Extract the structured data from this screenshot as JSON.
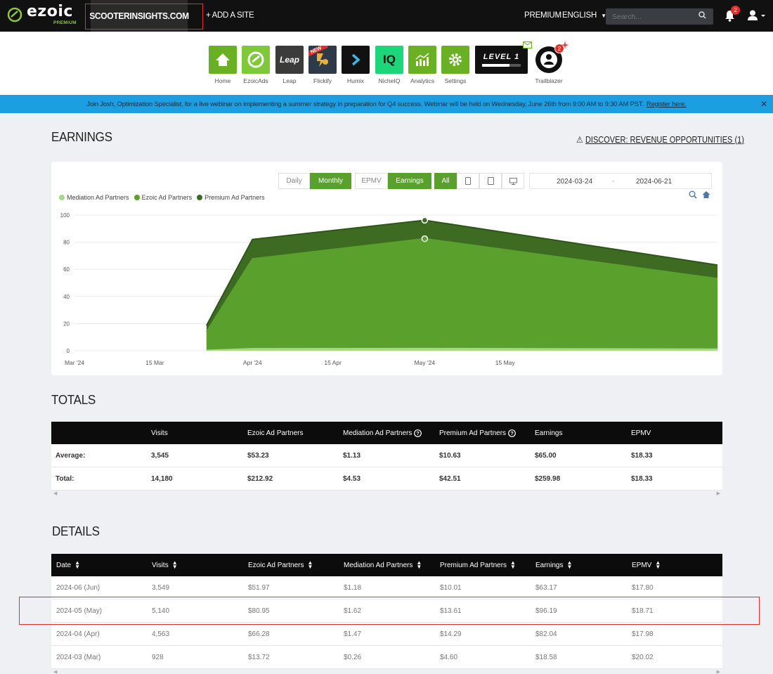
{
  "nav": {
    "logo": "ezoic",
    "logo_sub": "PREMIUM",
    "site": "SCOOTERINSIGHTS.COM",
    "add_site": "+ ADD A SITE",
    "premium": "PREMIUM",
    "language": "ENGLISH",
    "search_placeholder": "Search...",
    "notification_count": "2"
  },
  "apps": [
    {
      "label": "Home",
      "icon": "house-icon"
    },
    {
      "label": "EzoicAds",
      "icon": "ezoic-ads-icon"
    },
    {
      "label": "Leap",
      "icon": "leap-icon",
      "tile_text": "Leap"
    },
    {
      "label": "Flickify",
      "icon": "flickify-icon",
      "ribbon": "NEW"
    },
    {
      "label": "Humix",
      "icon": "humix-icon"
    },
    {
      "label": "NicheIQ",
      "icon": "nicheiq-icon",
      "tile_text": "IQ"
    },
    {
      "label": "Analytics",
      "icon": "analytics-icon"
    },
    {
      "label": "Settings",
      "icon": "gear-icon"
    },
    {
      "label": "",
      "icon": "level-icon",
      "tile_text": "LEVEL 1"
    },
    {
      "label": "Trailblazer",
      "icon": "trailblazer-icon",
      "badge": "2"
    }
  ],
  "banner": {
    "text": "Join Josh, Optimization Specialist, for a live webinar on implementing a summer strategy in preparation for Q4 success. Webinar will be held on Wednesday, June 26th from 9:00 AM to 9:30 AM PST.",
    "link": "Register here."
  },
  "earnings": {
    "title": "EARNINGS",
    "discover": "DISCOVER: REVENUE OPPORTUNITIES (1)",
    "buttons": {
      "daily": "Daily",
      "monthly": "Monthly",
      "epmv": "EPMV",
      "earnings": "Earnings",
      "all": "All"
    },
    "date_from": "2024-03-24",
    "date_sep": "-",
    "date_to": "2024-06-21"
  },
  "chart_data": {
    "type": "area",
    "stacked": true,
    "x": [
      "2024-03-24",
      "2024-04-01",
      "2024-05-01",
      "2024-06-21"
    ],
    "series": [
      {
        "name": "Mediation Ad Partners",
        "color": "#a5d98a",
        "values": [
          0.26,
          1.47,
          1.62,
          1.18
        ]
      },
      {
        "name": "Ezoic Ad Partners",
        "color": "#5aa02c",
        "values": [
          13.72,
          66.28,
          80.95,
          51.97
        ]
      },
      {
        "name": "Premium Ad Partners",
        "color": "#3d6b22",
        "values": [
          4.6,
          14.29,
          13.61,
          10.01
        ]
      }
    ],
    "ylim": [
      0,
      100
    ],
    "yticks": [
      0,
      20,
      40,
      60,
      80,
      100
    ],
    "xticks": [
      {
        "date": "2024-03-01",
        "label": "Mar '24"
      },
      {
        "date": "2024-03-15",
        "label": "15 Mar"
      },
      {
        "date": "2024-04-01",
        "label": "Apr '24"
      },
      {
        "date": "2024-04-15",
        "label": "15 Apr"
      },
      {
        "date": "2024-05-01",
        "label": "May '24"
      },
      {
        "date": "2024-05-15",
        "label": "15 May"
      }
    ],
    "highlighted": "2024-05-01",
    "grid": true,
    "legend": "top-left"
  },
  "totals": {
    "title": "TOTALS",
    "columns": [
      "",
      "Visits",
      "Ezoic Ad Partners",
      "Mediation Ad Partners",
      "Premium Ad Partners",
      "Earnings",
      "EPMV"
    ],
    "rows": [
      [
        "Average:",
        "3,545",
        "$53.23",
        "$1.13",
        "$10.63",
        "$65.00",
        "$18.33"
      ],
      [
        "Total:",
        "14,180",
        "$212.92",
        "$4.53",
        "$42.51",
        "$259.98",
        "$18.33"
      ]
    ]
  },
  "details": {
    "title": "DETAILS",
    "columns": [
      "Date",
      "Visits",
      "Ezoic Ad Partners",
      "Mediation Ad Partners",
      "Premium Ad Partners",
      "Earnings",
      "EPMV"
    ],
    "rows": [
      [
        "2024-06 (Jun)",
        "3,549",
        "$51.97",
        "$1.18",
        "$10.01",
        "$63.17",
        "$17.80"
      ],
      [
        "2024-05 (May)",
        "5,140",
        "$80.95",
        "$1.62",
        "$13.61",
        "$96.19",
        "$18.71"
      ],
      [
        "2024-04 (Apr)",
        "4,563",
        "$66.28",
        "$1.47",
        "$14.29",
        "$82.04",
        "$17.98"
      ],
      [
        "2024-03 (Mar)",
        "928",
        "$13.72",
        "$0.26",
        "$4.60",
        "$18.58",
        "$20.02"
      ]
    ]
  }
}
